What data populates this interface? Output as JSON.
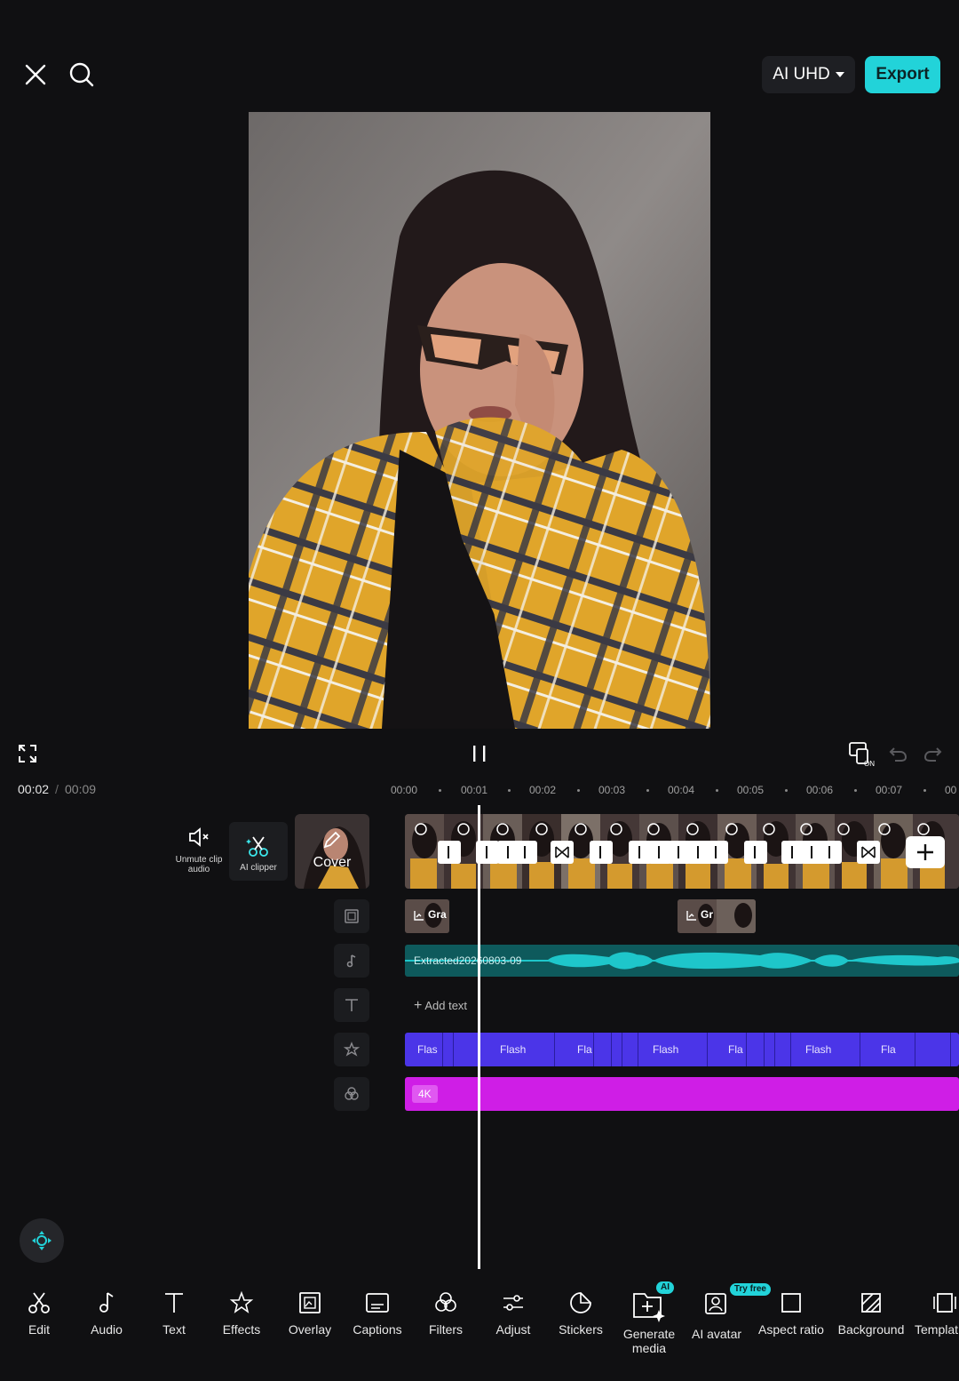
{
  "header": {
    "quality_label": "AI UHD",
    "export_label": "Export"
  },
  "playback": {
    "current_time": "00:02",
    "separator": "/",
    "total_time": "00:09"
  },
  "ruler": [
    "00:00",
    "00:01",
    "00:02",
    "00:03",
    "00:04",
    "00:05",
    "00:06",
    "00:07",
    "00"
  ],
  "side_tools": {
    "unmute": "Unmute clip audio",
    "ai_clipper": "AI clipper",
    "cover": "Cover"
  },
  "tracks": {
    "overlay_clips": [
      "Gra",
      "Gr"
    ],
    "audio_label": "Extracted20260803-09",
    "add_text": "Add text",
    "effects": [
      "Flas",
      "Flash",
      "Fla",
      "Flash",
      "Fla",
      "Flash",
      "Fla"
    ],
    "filter_label": "4K",
    "effect_color": "#4b35e8",
    "filter_color": "#cf1ee6",
    "audio_color": "#0e5a5c"
  },
  "toolbar": [
    {
      "label": "Edit",
      "icon": "scissors-icon"
    },
    {
      "label": "Audio",
      "icon": "music-note-icon"
    },
    {
      "label": "Text",
      "icon": "text-icon"
    },
    {
      "label": "Effects",
      "icon": "sparkle-star-icon"
    },
    {
      "label": "Overlay",
      "icon": "overlay-icon"
    },
    {
      "label": "Captions",
      "icon": "captions-icon"
    },
    {
      "label": "Filters",
      "icon": "filters-icon"
    },
    {
      "label": "Adjust",
      "icon": "sliders-icon"
    },
    {
      "label": "Stickers",
      "icon": "sticker-icon"
    },
    {
      "label": "Generate media",
      "icon": "generate-media-icon",
      "badge": "AI"
    },
    {
      "label": "AI avatar",
      "icon": "avatar-icon",
      "badge": "Try free"
    },
    {
      "label": "Aspect ratio",
      "icon": "aspect-ratio-icon"
    },
    {
      "label": "Background",
      "icon": "background-icon"
    },
    {
      "label": "Templat",
      "icon": "template-icon"
    }
  ],
  "colors": {
    "accent": "#22d3d9",
    "background": "#101012"
  }
}
